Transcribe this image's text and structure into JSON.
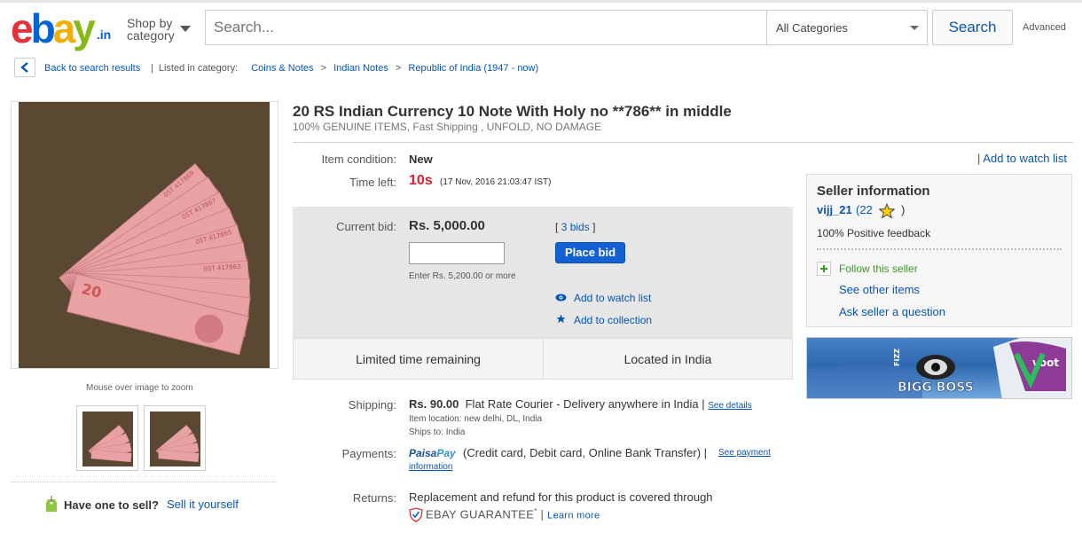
{
  "header": {
    "logo": {
      "e": "e",
      "b": "b",
      "a": "a",
      "y": "y",
      "tld": ".in"
    },
    "shop_by_line1": "Shop by",
    "shop_by_line2": "category",
    "search_placeholder": "Search...",
    "category_select": "All Categories",
    "search_button": "Search",
    "advanced": "Advanced"
  },
  "breadcrumb": {
    "back": "Back to search results",
    "listed_in": "Listed in category:",
    "items": [
      "Coins & Notes",
      "Indian Notes",
      "Republic of India (1947 - now)"
    ],
    "separator": ">"
  },
  "gallery": {
    "zoom_hint": "Mouse over image to zoom",
    "image_icon": "currency-notes-fan-image"
  },
  "sell": {
    "question": "Have one to sell?",
    "link": "Sell it yourself"
  },
  "item": {
    "title": "20 RS Indian Currency 10 Note With Holy no **786** in middle",
    "subtitle": "100% GENUINE ITEMS, Fast Shipping , UNFOLD, NO DAMAGE",
    "condition_label": "Item condition:",
    "condition_value": "New",
    "time_label": "Time left:",
    "time_value": "10s",
    "time_end": "(17 Nov, 2016  21:03:47 IST)"
  },
  "bid": {
    "label": "Current bid:",
    "value": "Rs. 5,000.00",
    "input_value": "",
    "hint": "Enter Rs. 5,200.00 or more",
    "bids_open": "[",
    "bids_link": "3 bids",
    "bids_close": "]",
    "place_bid": "Place bid",
    "watch": "Add to watch list",
    "collection": "Add to collection"
  },
  "strip": {
    "limited": "Limited time remaining",
    "located": "Located in India"
  },
  "shipping": {
    "label": "Shipping:",
    "price": "Rs. 90.00",
    "method": "Flat Rate Courier - Delivery anywhere in India |",
    "details": "See details",
    "location": "Item location:  new delhi, DL, India",
    "ships_to": "Ships to:  India"
  },
  "payments": {
    "label": "Payments:",
    "paisa": "Paisa",
    "pay": "Pay",
    "text": "(Credit card, Debit card, Online Bank Transfer)  |",
    "link1": "See payment",
    "link2": "information"
  },
  "returns": {
    "label": "Returns:",
    "text": "Replacement and refund for this product is covered through",
    "guarantee": "EBAY GUARANTEE",
    "guarantee_mark": "*",
    "sep": "|",
    "learn": "Learn more"
  },
  "right": {
    "watch_sep": "|",
    "watch": "Add to watch list",
    "seller_heading": "Seller information",
    "seller_name": "vijj_21",
    "seller_score": "(22",
    "seller_paren": ")",
    "positive": "100% Positive feedback",
    "follow": "Follow this seller",
    "see_other": "See other items",
    "ask": "Ask seller a question"
  },
  "ad": {
    "brand_fizz": "FIZZ",
    "show": "BIGG BOSS",
    "channel": "voot"
  },
  "colors": {
    "link": "#0654ba",
    "time_red": "#dd1e31",
    "place_bid_blue": "#1260d1",
    "follow_green": "#3a9b23"
  }
}
